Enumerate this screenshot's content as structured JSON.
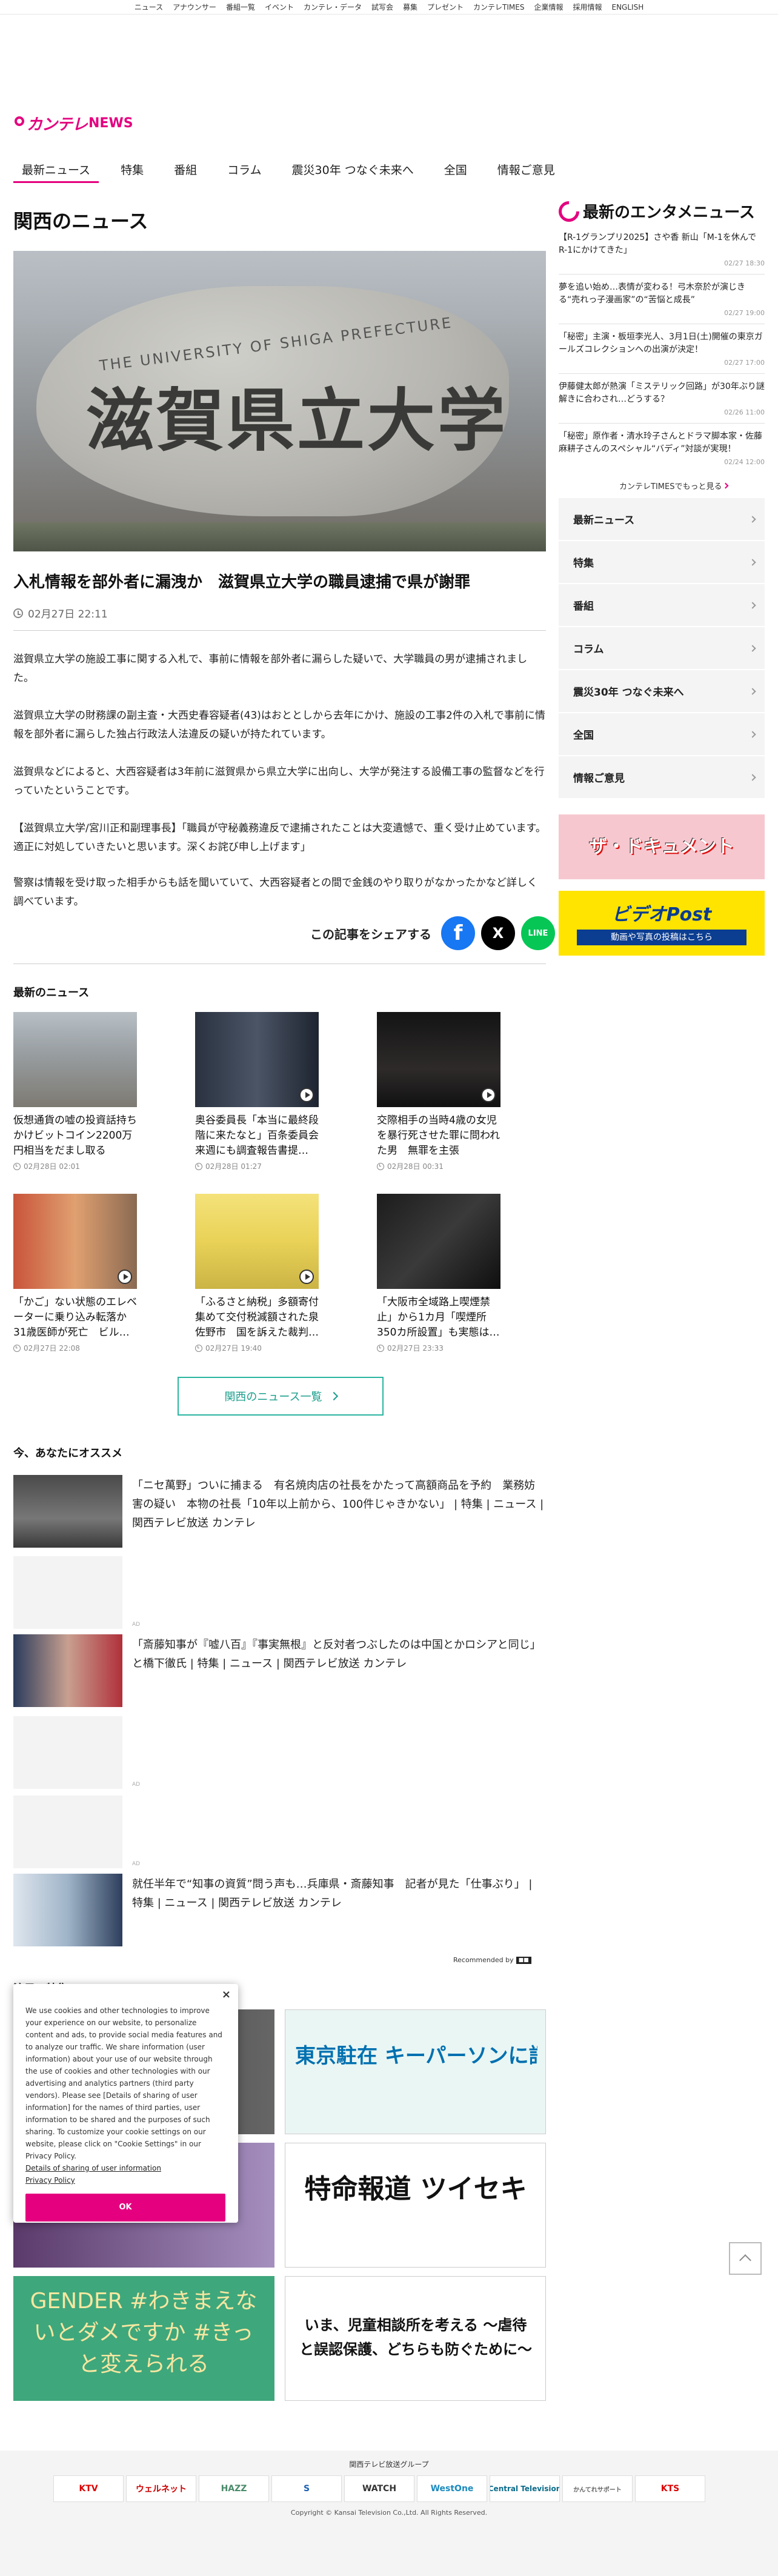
{
  "topnav": [
    "ニュース",
    "アナウンサー",
    "番組一覧",
    "イベント",
    "カンテレ・データ",
    "試写会",
    "募集",
    "プレゼント",
    "カンテレTIMES",
    "企業情報",
    "採用情報",
    "ENGLISH"
  ],
  "logo": {
    "brand": "カンテレ",
    "suffix": "NEWS"
  },
  "gnav": [
    {
      "label": "最新ニュース",
      "active": true
    },
    {
      "label": "特集"
    },
    {
      "label": "番組"
    },
    {
      "label": "コラム"
    },
    {
      "label": "震災30年 つなぐ未来へ"
    },
    {
      "label": "全国"
    },
    {
      "label": "情報ご意見"
    }
  ],
  "section_title": "関西のニュース",
  "article": {
    "hero_text_jp": "滋賀県立大学",
    "hero_text_en": "THE UNIVERSITY OF SHIGA PREFECTURE",
    "headline": "入札情報を部外者に漏洩か　滋賀県立大学の職員逮捕で県が謝罪",
    "date": "02月27日 22:11",
    "paragraphs": [
      "滋賀県立大学の施設工事に関する入札で、事前に情報を部外者に漏らした疑いで、大学職員の男が逮捕されました。",
      "滋賀県立大学の財務課の副主査・大西史春容疑者(43)はおととしから去年にかけ、施設の工事2件の入札で事前に情報を部外者に漏らした独占行政法人法違反の疑いが持たれています。",
      "滋賀県などによると、大西容疑者は3年前に滋賀県から県立大学に出向し、大学が発注する設備工事の監督などを行っていたということです。",
      "【滋賀県立大学/宮川正和副理事長】「職員が守秘義務違反で逮捕されたことは大変遺憾で、重く受け止めています。適正に対処していきたいと思います。深くお詫び申し上げます」",
      "警察は情報を受け取った相手からも話を聞いていて、大西容疑者との間で金銭のやり取りがなかったかなど詳しく調べています。"
    ],
    "share_label": "この記事をシェアする",
    "share_buttons": [
      "f",
      "X",
      "LINE"
    ]
  },
  "latest": {
    "title": "最新のニュース",
    "items": [
      {
        "title": "仮想通貨の嘘の投資話持ちかけビットコイン2200万円相当をだまし取る",
        "date": "02月28日 02:01"
      },
      {
        "title": "奥谷委員長「本当に最終段階に来たなと」百条委員会　来週にも調査報告書提…",
        "date": "02月28日 01:27"
      },
      {
        "title": "交際相手の当時4歳の女児を暴行死させた罪に問われた男　無罪を主張",
        "date": "02月28日 00:31"
      },
      {
        "title": "「かご」ない状態のエレベーターに乗り込み転落か　31歳医師が死亡　ビル…",
        "date": "02月27日 22:08"
      },
      {
        "title": "「ふるさと納税」多額寄付集めて交付税減額された泉佐野市　国を訴えた裁判…",
        "date": "02月27日 19:40"
      },
      {
        "title": "「大阪市全域路上喫煙禁止」から1カ月「喫煙所350カ所設置」も実態は…",
        "date": "02月27日 23:33"
      }
    ],
    "more_label": "関西のニュース一覧"
  },
  "recommend": {
    "title": "今、あなたにオススメ",
    "items": [
      {
        "text": "「ニセ萬野」ついに捕まる　有名焼肉店の社長をかたって高額商品を予約　業務妨害の疑い　本物の社長「10年以上前から、100件じゃきかない」 | 特集 | ニュース | 関西テレビ放送 カンテレ",
        "ad": false
      },
      {
        "text": "AD",
        "ad": true
      },
      {
        "text": "「斎藤知事が『嘘八百』『事実無根』と反対者つぶしたのは中国とかロシアと同じ」と橋下徹氏 | 特集 | ニュース | 関西テレビ放送 カンテレ",
        "ad": false
      },
      {
        "text": "AD",
        "ad": true
      },
      {
        "text": "AD",
        "ad": true
      },
      {
        "text": "就任半年で“知事の資質”問う声も…兵庫県・斎藤知事　記者が見た「仕事ぶり」 | 特集 | ニュース | 関西テレビ放送 カンテレ",
        "ad": false
      }
    ],
    "recommended_by": "Recommended by"
  },
  "notice_title": "注目の特集",
  "banners": [
    "東京駐在 キーパーソンに訊く",
    "特命報道 ツイセキ",
    "GENDER #わきまえないとダメですか #きっと変えられる",
    "いま、児童相談所を考える ～虐待と誤認保護、どちらも防ぐために～"
  ],
  "side": {
    "title": "最新のエンタメニュース",
    "items": [
      {
        "text": "【R-1グランプリ2025】さや香 新山「M-1を休んでR-1にかけてきた」",
        "date": "02/27 18:30"
      },
      {
        "text": "夢を追い始め…表情が変わる！弓木奈於が演じきる“売れっ子漫画家”の“苦悩と成長”",
        "date": "02/27 19:00"
      },
      {
        "text": "「秘密」主演・板垣李光人、3月1日(土)開催の東京ガールズコレクションへの出演が決定！",
        "date": "02/27 17:00"
      },
      {
        "text": "伊藤健太郎が熱演「ミステリック回路」が30年ぶり謎解きに合わされ…どうする？",
        "date": "02/26 11:00"
      },
      {
        "text": "「秘密」原作者・清水玲子さんとドラマ脚本家・佐藤麻耕子さんのスペシャル“バディ”対談が実現！",
        "date": "02/24 12:00"
      }
    ],
    "times_link": "カンテレTIMESでもっと見る",
    "menu": [
      "最新ニュース",
      "特集",
      "番組",
      "コラム",
      "震災30年 つなぐ未来へ",
      "全国",
      "情報ご意見"
    ],
    "banner1": "ザ・ドキュメント",
    "banner2_top": "ビデオPost",
    "banner2_bottom": "動画や写真の投稿はこちら"
  },
  "cookie": {
    "text": "We use cookies and other technologies to improve your experience on our website, to personalize content and ads, to provide social media features and to analyze our traffic. We share information (user information) about your use of our website through the use of cookies and other technologies with our advertising and analytics partners (third party vendors). Please see [Details of sharing of user information] for the names of third parties, user information to be shared and the purposes of such sharing. To customize your cookie settings on our website, please click on \"Cookie Settings\" in our Privacy Policy.",
    "link1": "Details of sharing of user information",
    "link2": "Privacy Policy",
    "ok": "OK"
  },
  "footer": {
    "group": "関西テレビ放送グループ",
    "logos": [
      "KTV",
      "ウェルネット",
      "HAZZ",
      "S",
      "WATCH",
      "WestOne",
      "Central Television",
      "かんてれサポート",
      "KTS"
    ],
    "copyright": "Copyright © Kansai Television Co.,Ltd. All Rights Reserved."
  },
  "colors": {
    "accent": "#e4007f",
    "teal": "#1a9e8c"
  }
}
